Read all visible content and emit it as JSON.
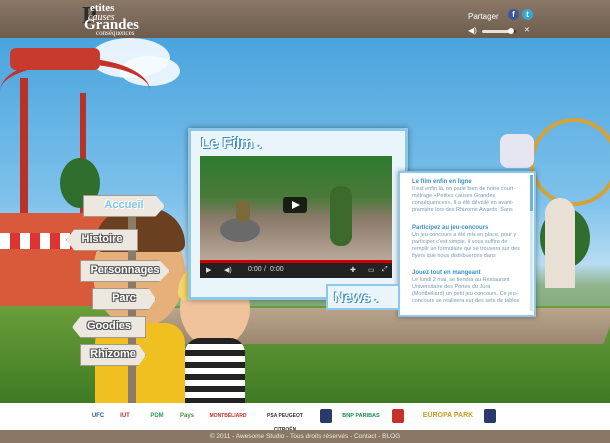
{
  "logo": {
    "line1": "etites",
    "line2": "causes",
    "line3": "randes",
    "line4": "conséquences",
    "capP": "P",
    "capG": "G"
  },
  "header": {
    "share_label": "Partager",
    "facebook": "f",
    "twitter": "t",
    "close": "✕"
  },
  "film": {
    "title": "Le Film .",
    "time": "0:00",
    "duration": "0:00"
  },
  "news": {
    "title": "News .",
    "items": [
      {
        "heading": "Le film enfin en ligne",
        "text": "Il est enfin là, on parle bien de notre court-métrage «Petites causes Grandes conséquences». Il a été dévoilé en avant-première lors des Rhizome Awards. Sans"
      },
      {
        "heading": "Participez au jeu-concours",
        "text": "Un jeu concours a été mis en place, pour y participer c'est simple, il vous suffira de remplir un formulaire qui se trouvera sur des flyers que nous distribuerons dans"
      },
      {
        "heading": "Jouez tout en mangeant",
        "text": "Le lundi 2 mai, se tiendra au Restaurant Universitaire des Portes du Jura (Montbéliard) un petit jeu concours. Ce jeu-concours se réalisera sur des sets de tables"
      }
    ]
  },
  "nav": [
    "Accueil",
    "Histoire",
    "Personnages",
    "Parc",
    "Goodies",
    "Rhizome"
  ],
  "partners": [
    "UFC",
    "IUT",
    "PDM",
    "Pays",
    "MONTBÉLIARD",
    "PSA PEUGEOT CITROËN",
    "BNP PARIBAS",
    "EUROPA PARK"
  ],
  "footer": {
    "copyright": "© 2011 - Awesome Studio - Tous droits réservés - Contact - BLOG"
  },
  "colors": {
    "panel_border": "#8ec8e8",
    "heading_blue": "#3a8fd0",
    "top_bar": "#7c6a5a"
  }
}
